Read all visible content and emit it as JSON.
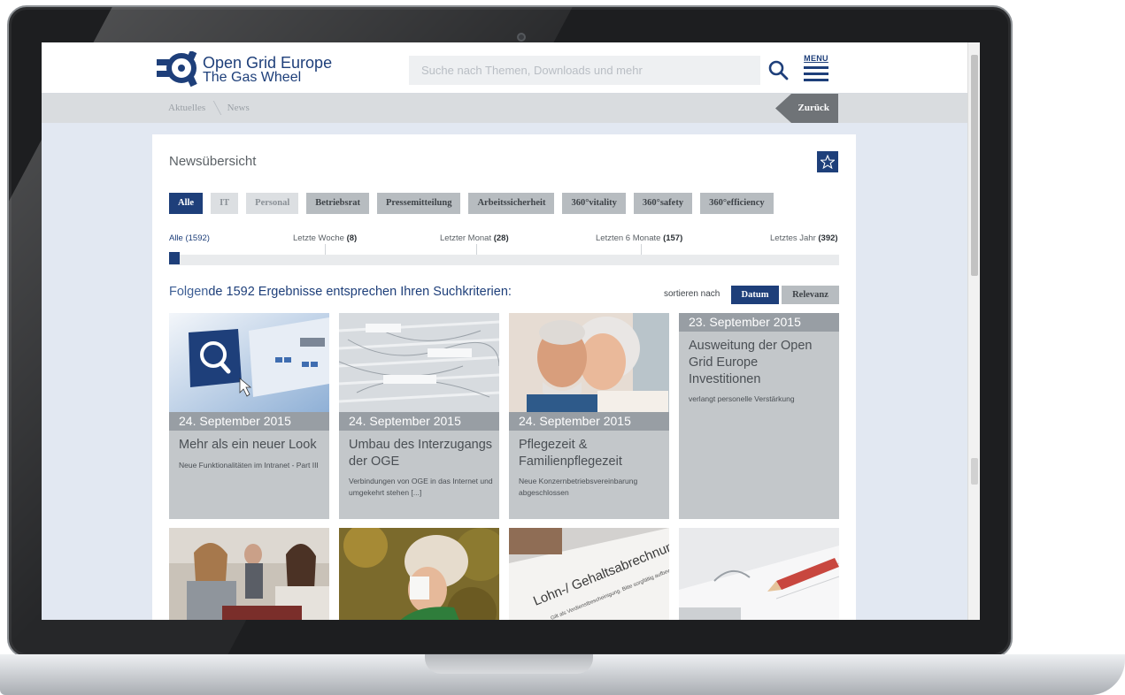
{
  "header": {
    "logo_line1": "Open Grid Europe",
    "logo_line2": "The Gas Wheel",
    "search_placeholder": "Suche nach Themen, Downloads und mehr",
    "menu_label": "MENU"
  },
  "breadcrumb": {
    "items": [
      "Aktuelles",
      "News"
    ],
    "back_label": "Zurück"
  },
  "panel": {
    "title": "Newsübersicht",
    "filters": [
      "Alle",
      "IT",
      "Personal",
      "Betriebsrat",
      "Pressemitteilung",
      "Arbeitssicherheit",
      "360°vitality",
      "360°safety",
      "360°efficiency"
    ],
    "active_filter": "Alle"
  },
  "timeline": {
    "ranges": [
      {
        "label": "Alle ",
        "count": "(1592)"
      },
      {
        "label": "Letzte Woche ",
        "count": "(8)"
      },
      {
        "label": "Letzter Monat ",
        "count": "(28)"
      },
      {
        "label": "Letzten 6 Monate ",
        "count": "(157)"
      },
      {
        "label": "Letztes Jahr ",
        "count": "(392)"
      }
    ]
  },
  "results": {
    "heading_pre": "Folgen",
    "heading_post": "de 1592 Ergebnisse entsprechen Ihren Suchkriterien:",
    "sort_label": "sortieren nach",
    "sort_date": "Datum",
    "sort_relevance": "Relevanz",
    "active_sort": "Datum"
  },
  "cards": [
    {
      "date": "24. September 2015",
      "title": "Mehr als ein neuer Look",
      "subtitle": "Neue Funktionalitäten im Intranet - Part III"
    },
    {
      "date": "24. September 2015",
      "title": "Umbau des Interzugangs der OGE",
      "subtitle": "Verbindungen von OGE in das Internet und umgekehrt stehen [...]"
    },
    {
      "date": "24. September 2015",
      "title": "Pflegezeit & Familienpflegezeit",
      "subtitle": "Neue Konzernbetriebsvereinbarung abgeschlossen"
    },
    {
      "date": "23. September 2015",
      "title": "Ausweitung der Open Grid Europe Investitionen",
      "subtitle": "verlangt personelle Verstärkung"
    }
  ],
  "colors": {
    "brand": "#1e3f7a",
    "chip_gray": "#b7bcc0",
    "card_gray": "#c3c7ca"
  },
  "icons": [
    "logo-icon",
    "search-icon",
    "menu-icon",
    "star-icon",
    "magnifier-tile-icon",
    "cursor-icon"
  ]
}
